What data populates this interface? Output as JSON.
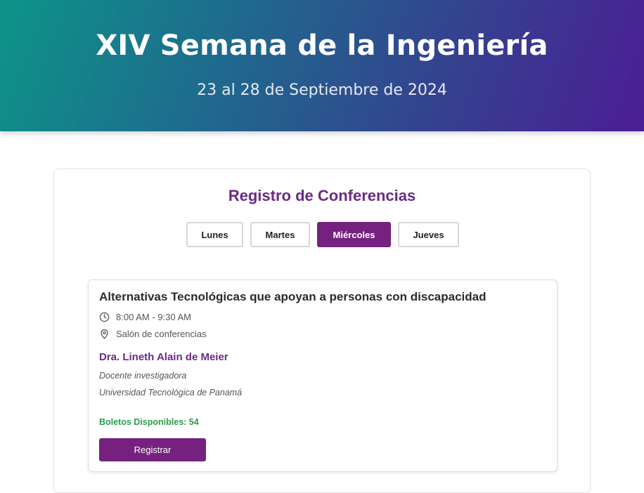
{
  "hero": {
    "title": "XIV Semana de la Ingeniería",
    "dates": "23 al 28 de Septiembre de 2024"
  },
  "registration": {
    "title": "Registro de Conferencias",
    "days": [
      {
        "label": "Lunes",
        "selected": false
      },
      {
        "label": "Martes",
        "selected": false
      },
      {
        "label": "Miércoles",
        "selected": true
      },
      {
        "label": "Jueves",
        "selected": false
      }
    ]
  },
  "conference": {
    "title": "Alternativas Tecnológicas que apoyan a personas con discapacidad",
    "time": "8:00 AM - 9:30 AM",
    "time_icon": "clock-icon",
    "location": "Salón de conferencias",
    "location_icon": "map-pin-icon",
    "speaker": "Dra. Lineth Alain de Meier",
    "speaker_role": "Docente investigadora",
    "speaker_org": "Universidad Tecnológica de Panamá",
    "tickets": "Boletos Disponibles: 54",
    "register_label": "Registrar"
  },
  "colors": {
    "brand_purple": "#76217f",
    "title_purple": "#6b2a84",
    "available_green": "#2a9d4a",
    "gradient_start": "#0d9488",
    "gradient_end": "#4c1d95"
  }
}
